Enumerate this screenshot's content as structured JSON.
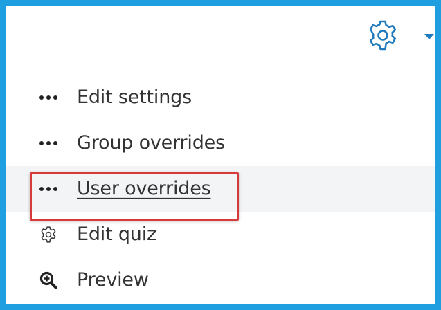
{
  "header": {
    "settings_icon": "gear-icon",
    "caret_icon": "caret-down-icon",
    "accent_color": "#1f7bbd",
    "frame_color": "#1f9fe0"
  },
  "menu": {
    "items": [
      {
        "label": "Edit settings",
        "icon": "more-dots-icon"
      },
      {
        "label": "Group overrides",
        "icon": "more-dots-icon"
      },
      {
        "label": "User overrides",
        "icon": "more-dots-icon",
        "active": true
      },
      {
        "label": "Edit quiz",
        "icon": "gear-icon"
      },
      {
        "label": "Preview",
        "icon": "zoom-in-icon"
      }
    ]
  },
  "annotation": {
    "highlight_color": "#d63a3a"
  }
}
